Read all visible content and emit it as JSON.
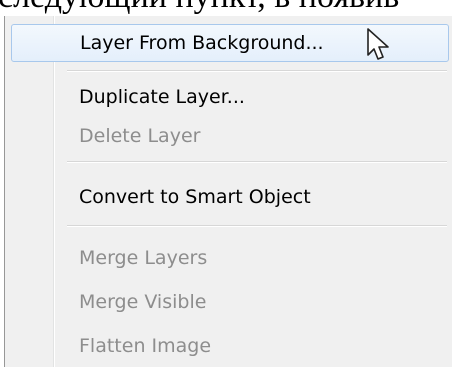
{
  "background_text": "следующий пункт, в появив",
  "menu": {
    "items": [
      {
        "label": "Layer From Background...",
        "enabled": true,
        "highlighted": true
      },
      {
        "label": "Duplicate Layer...",
        "enabled": true,
        "highlighted": false
      },
      {
        "label": "Delete Layer",
        "enabled": false,
        "highlighted": false
      },
      {
        "label": "Convert to Smart Object",
        "enabled": true,
        "highlighted": false
      },
      {
        "label": "Merge Layers",
        "enabled": false,
        "highlighted": false
      },
      {
        "label": "Merge Visible",
        "enabled": false,
        "highlighted": false
      },
      {
        "label": "Flatten Image",
        "enabled": false,
        "highlighted": false
      }
    ]
  },
  "cursor": {
    "icon": "mouse-pointer-icon"
  },
  "colors": {
    "enabled_text": "#000000",
    "disabled_text": "#8d8d8d",
    "highlight_border": "#a8c8ec",
    "menu_background": "#f0f0f0"
  }
}
